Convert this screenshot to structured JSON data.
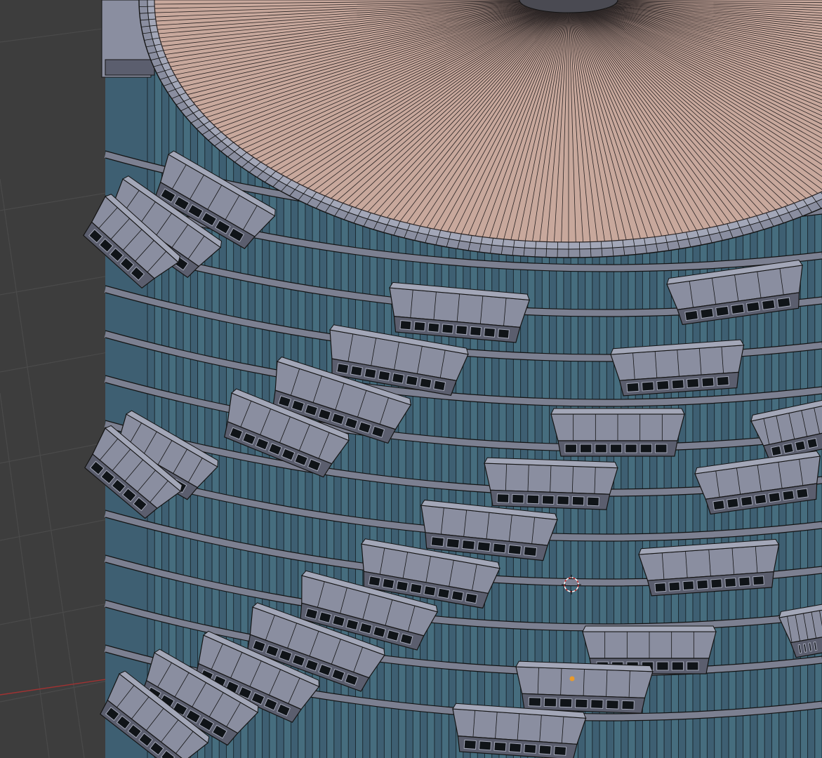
{
  "app": {
    "name": "",
    "mode": "edit-mesh-wireframe"
  },
  "viewport": {
    "background_color": "#3d3d3d",
    "grid_color": "#4a4a4a",
    "x_axis_color": "#a03232",
    "grid_visible": true
  },
  "model": {
    "object": "cylindrical-tower",
    "roof_color": "#c8a89c",
    "roof_edge_color": "#2a2424",
    "glass_color": "#3e5f72",
    "glass_light_color": "#4d7888",
    "mullion_color": "#1c2a32",
    "balcony_color": "#8a8ea0",
    "balcony_light_color": "#a3a7b8",
    "balcony_dark_color": "#5b5e6e",
    "slab_color": "#7c8091",
    "wire_color": "#141414"
  },
  "overlays": {
    "cursor_3d": {
      "icon": "3d-cursor-icon",
      "color": "#c83232"
    },
    "origin": {
      "icon": "object-origin-icon",
      "color": "#e89a2c"
    }
  }
}
